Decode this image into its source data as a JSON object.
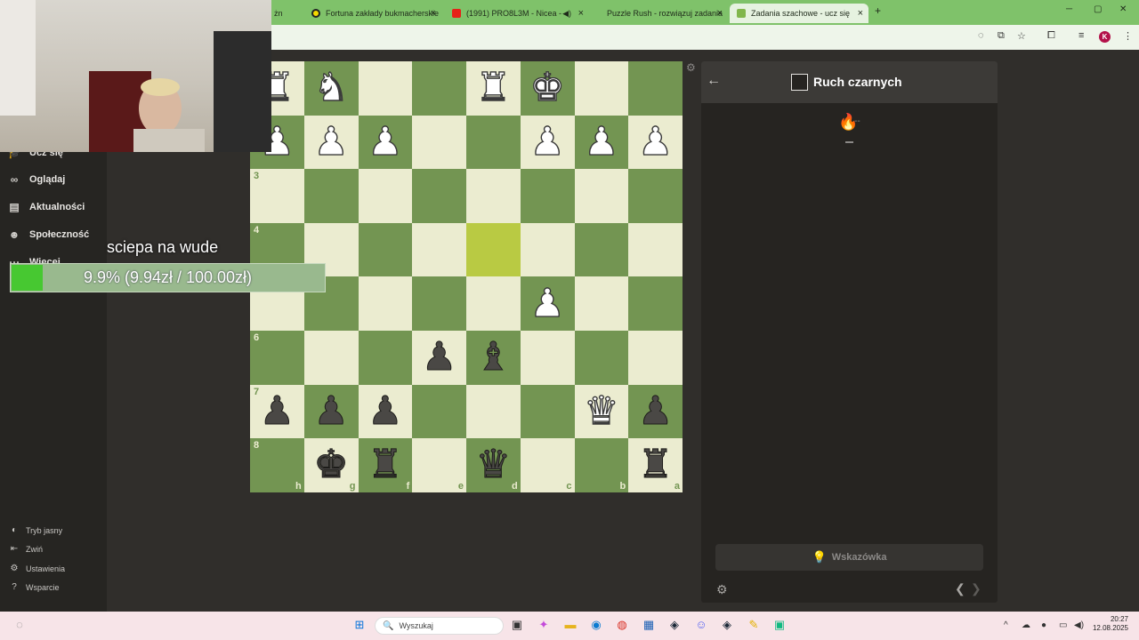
{
  "browser": {
    "tabs": [
      {
        "label": "żn",
        "close": "×"
      },
      {
        "label": "Fortuna zakłady bukmacherskie",
        "close": "×"
      },
      {
        "label": "(1991) PRO8L3M - Nicea -",
        "close": "×"
      },
      {
        "label": "Puzzle Rush - rozwiązuj zadania",
        "close": "×"
      },
      {
        "label": "Zadania szachowe - ucz się",
        "close": "×"
      }
    ],
    "new_tab": "+",
    "window_controls": {
      "minimize": "─",
      "maximize": "▢",
      "close": "✕"
    },
    "profile_initial": "K"
  },
  "sidebar": {
    "items": [
      {
        "label": "Ucz się",
        "icon": "graduation-icon"
      },
      {
        "label": "Oglądaj",
        "icon": "binoculars-icon"
      },
      {
        "label": "Aktualności",
        "icon": "news-icon"
      },
      {
        "label": "Społeczność",
        "icon": "community-icon"
      },
      {
        "label": "Więcej",
        "icon": "more-icon"
      }
    ],
    "footer": [
      {
        "label": "Tryb jasny",
        "icon": "contrast-icon"
      },
      {
        "label": "Zwiń",
        "icon": "collapse-icon"
      },
      {
        "label": "Ustawienia",
        "icon": "gear-icon"
      },
      {
        "label": "Wsparcie",
        "icon": "help-icon"
      }
    ]
  },
  "overlay": {
    "donation_title": "sciepa na wude",
    "donation_text": "9.9% (9.94zł / 100.00zł)",
    "donation_progress": 0.099
  },
  "board": {
    "orientation": "black",
    "ranks_shown": [
      "3",
      "4",
      "6",
      "7",
      "8"
    ],
    "files": [
      "h",
      "g",
      "f",
      "e",
      "d",
      "c",
      "b",
      "a"
    ],
    "highlight": "d4",
    "pieces": [
      {
        "sq": "h1",
        "piece": "R",
        "color": "white"
      },
      {
        "sq": "g1",
        "piece": "N",
        "color": "white"
      },
      {
        "sq": "d1",
        "piece": "R",
        "color": "white"
      },
      {
        "sq": "c1",
        "piece": "K",
        "color": "white"
      },
      {
        "sq": "h2",
        "piece": "P",
        "color": "white"
      },
      {
        "sq": "g2",
        "piece": "P",
        "color": "white"
      },
      {
        "sq": "f2",
        "piece": "P",
        "color": "white"
      },
      {
        "sq": "c2",
        "piece": "P",
        "color": "white"
      },
      {
        "sq": "b2",
        "piece": "P",
        "color": "white"
      },
      {
        "sq": "a2",
        "piece": "P",
        "color": "white"
      },
      {
        "sq": "c5",
        "piece": "P",
        "color": "white"
      },
      {
        "sq": "e6",
        "piece": "P",
        "color": "black"
      },
      {
        "sq": "d6",
        "piece": "B",
        "color": "black"
      },
      {
        "sq": "h7",
        "piece": "P",
        "color": "black"
      },
      {
        "sq": "g7",
        "piece": "P",
        "color": "black"
      },
      {
        "sq": "f7",
        "piece": "P",
        "color": "black"
      },
      {
        "sq": "b7",
        "piece": "Q",
        "color": "white"
      },
      {
        "sq": "a7",
        "piece": "P",
        "color": "black"
      },
      {
        "sq": "g8",
        "piece": "K",
        "color": "black"
      },
      {
        "sq": "f8",
        "piece": "R",
        "color": "black"
      },
      {
        "sq": "d8",
        "piece": "Q",
        "color": "black"
      },
      {
        "sq": "a8",
        "piece": "R",
        "color": "black"
      }
    ]
  },
  "panel": {
    "turn_label": "Ruch czarnych",
    "streak_value": "--",
    "hint_label": "Wskazówka"
  },
  "taskbar": {
    "search_placeholder": "Wyszukaj",
    "time": "20:27",
    "date": "12.08.2025"
  },
  "colors": {
    "board_light": "#ebecd0",
    "board_dark": "#739552",
    "highlight": "#b9ca43",
    "tabbar": "#7fc26a",
    "progress_fill": "#47c831"
  }
}
